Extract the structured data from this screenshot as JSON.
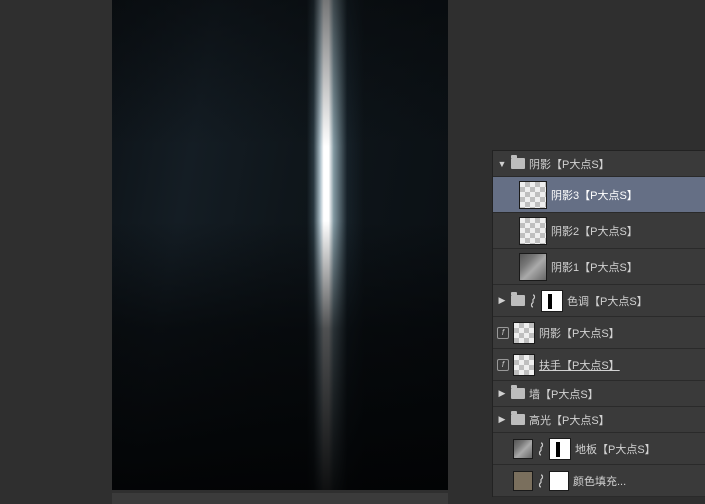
{
  "canvas": {
    "name": "document-preview"
  },
  "layers_panel": {
    "rows": [
      {
        "kind": "folder",
        "expand": "down",
        "label": "阴影【P大点S】",
        "indent": 0
      },
      {
        "kind": "layer",
        "thumb": "checker",
        "label": "阴影3【P大点S】",
        "indent": 1,
        "selected": true
      },
      {
        "kind": "layer",
        "thumb": "checker",
        "label": "阴影2【P大点S】",
        "indent": 1
      },
      {
        "kind": "layer",
        "thumb": "mix",
        "label": "阴影1【P大点S】",
        "indent": 1
      },
      {
        "kind": "folder",
        "expand": "right",
        "mask": true,
        "label": "色调【P大点S】",
        "indent": 0
      },
      {
        "kind": "layer",
        "fx": true,
        "thumb": "checker",
        "label": "阴影【P大点S】",
        "indent": 0
      },
      {
        "kind": "layer",
        "fx": true,
        "thumb": "checker",
        "label": "扶手【P大点S】",
        "indent": 0,
        "underline": true
      },
      {
        "kind": "folder",
        "expand": "right",
        "label": "墙【P大点S】",
        "indent": 0
      },
      {
        "kind": "folder",
        "expand": "right",
        "label": "高光【P大点S】",
        "indent": 0
      },
      {
        "kind": "layer",
        "fx": false,
        "thumb": "mix",
        "mask": true,
        "label": "地板【P大点S】",
        "indent": 0
      },
      {
        "kind": "layer",
        "fx": false,
        "thumb": "solid",
        "mask": true,
        "maskStyle": "white",
        "label": "颜色填充...",
        "indent": 0
      }
    ]
  }
}
